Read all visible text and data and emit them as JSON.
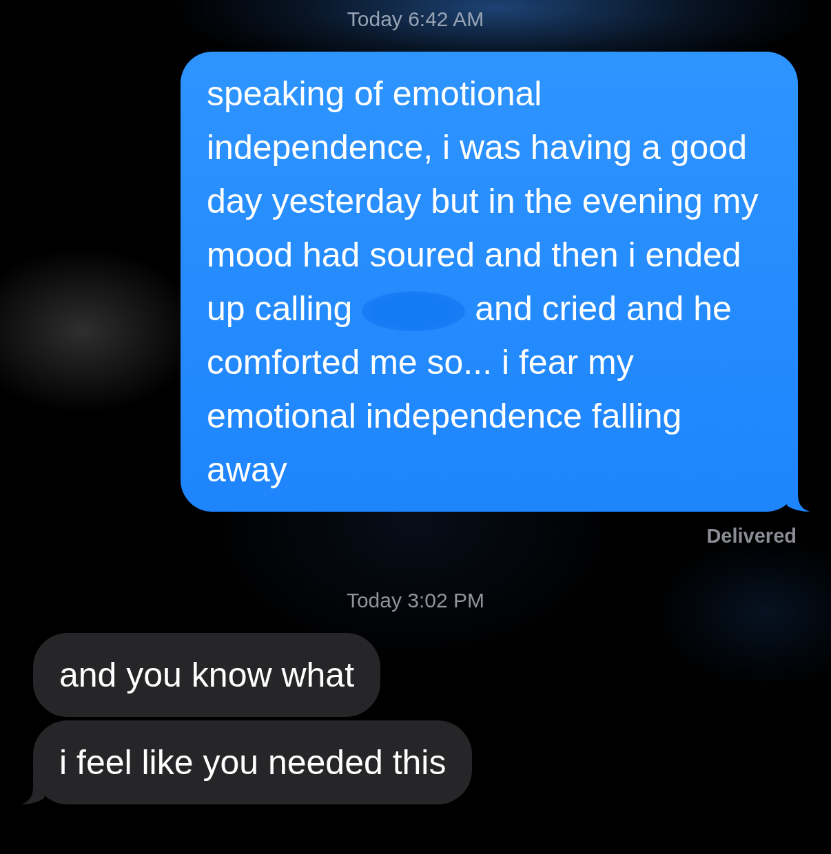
{
  "conversation": [
    {
      "kind": "timestamp",
      "text": "Today 6:42 AM"
    },
    {
      "kind": "outgoing_message",
      "tail": true,
      "blocks": [
        {
          "kind": "paragraph",
          "text": "speaking of emotional independence, i was having a good day yesterday but in the evening my mood had soured and then i ended"
        },
        {
          "kind": "line",
          "parts": [
            {
              "kind": "text",
              "text": "up calling"
            },
            {
              "kind": "redaction"
            },
            {
              "kind": "text",
              "text": "and cried and he"
            }
          ]
        },
        {
          "kind": "paragraph",
          "text": "comforted me so... i fear my emotional independence falling away"
        }
      ]
    },
    {
      "kind": "status",
      "text": "Delivered"
    },
    {
      "kind": "timestamp",
      "text": "Today 3:02 PM"
    },
    {
      "kind": "incoming_message",
      "tail": false,
      "blocks": [
        {
          "kind": "paragraph",
          "text": "and you know what"
        }
      ]
    },
    {
      "kind": "incoming_message",
      "tail": true,
      "blocks": [
        {
          "kind": "paragraph",
          "text": "i feel like you needed this"
        }
      ]
    }
  ]
}
